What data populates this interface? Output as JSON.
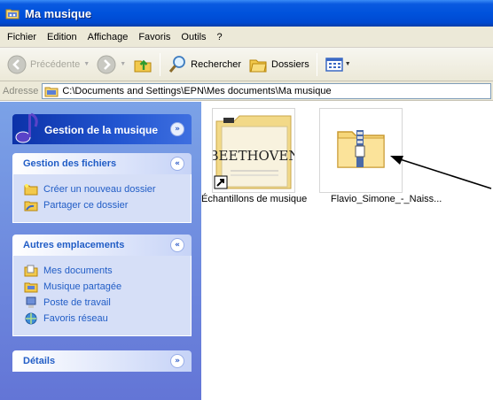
{
  "window": {
    "title": "Ma musique"
  },
  "menu": [
    "Fichier",
    "Edition",
    "Affichage",
    "Favoris",
    "Outils",
    "?"
  ],
  "toolbar": {
    "back_label": "Précédente",
    "search_label": "Rechercher",
    "folders_label": "Dossiers"
  },
  "address": {
    "label": "Adresse",
    "path": "C:\\Documents and Settings\\EPN\\Mes documents\\Ma musique"
  },
  "taskpane": {
    "main_title": "Gestion de la musique",
    "files": {
      "title": "Gestion des fichiers",
      "items": [
        "Créer un nouveau dossier",
        "Partager ce dossier"
      ]
    },
    "places": {
      "title": "Autres emplacements",
      "items": [
        "Mes documents",
        "Musique partagée",
        "Poste de travail",
        "Favoris réseau"
      ]
    },
    "details": {
      "title": "Détails"
    }
  },
  "files": [
    {
      "name": "Échantillons de musique",
      "art_text": "BEETHOVEN",
      "shortcut": true
    },
    {
      "name": "Flavio_Simone_-_Naiss...",
      "zip": true
    }
  ],
  "colors": {
    "title_bar": "#0052dc",
    "taskpane_bg": "#7ba2e7",
    "link": "#215dc6",
    "chrome": "#ece9d8"
  }
}
